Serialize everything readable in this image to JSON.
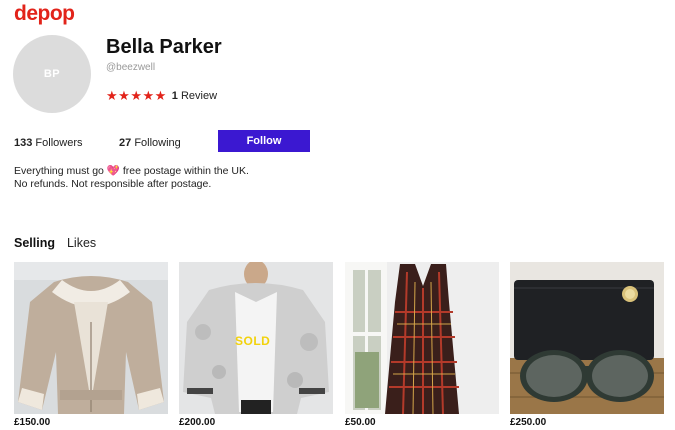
{
  "brand": {
    "logo": "depop"
  },
  "profile": {
    "avatar_initials": "BP",
    "name": "Bella Parker",
    "username": "@beezwell",
    "stars": 5,
    "review_count": "1",
    "review_label": "Review",
    "followers_count": "133",
    "followers_label": "Followers",
    "following_count": "27",
    "following_label": "Following",
    "follow_button": "Follow",
    "bio_before": "Everything must go",
    "bio_emoji": "💖",
    "bio_after": "free postage within the UK. No refunds. Not responsible after postage."
  },
  "tabs": {
    "selling": "Selling",
    "likes": "Likes"
  },
  "products": [
    {
      "price": "£150.00"
    },
    {
      "price": "£200.00",
      "badge": "SOLD"
    },
    {
      "price": "£50.00"
    },
    {
      "price": "£250.00"
    }
  ],
  "colors": {
    "brand_red": "#e2231a",
    "follow_purple": "#3b18d1",
    "star_red": "#e2231a",
    "sold_yellow": "#f2d20c"
  }
}
